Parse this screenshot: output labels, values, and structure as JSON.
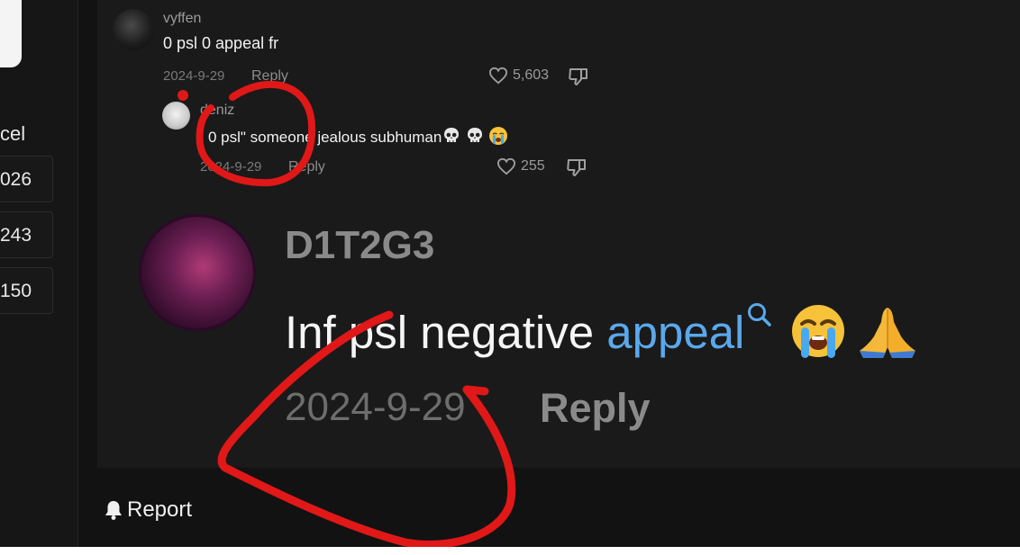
{
  "sidebar": {
    "partial_label": "cel",
    "codes": [
      "026",
      "243",
      "150"
    ]
  },
  "comment_vyffen": {
    "username": "vyffen",
    "text": "0 psl 0 appeal fr",
    "date": "2024-9-29",
    "reply_label": "Reply",
    "likes": "5,603"
  },
  "reply_deniz": {
    "username": "deniz",
    "text": "0 psl\" someone jealous subhuman",
    "emojis": [
      "skull",
      "skull",
      "crying"
    ],
    "date": "2024-9-29",
    "reply_label": "Reply",
    "likes": "255"
  },
  "comment_d1t2g3": {
    "username": "D1T2G3",
    "text_plain": "Inf psl negative ",
    "text_link": "appeal",
    "emojis": [
      "loudly-crying",
      "folded-hands"
    ],
    "date": "2024-9-29",
    "reply_label": "Reply"
  },
  "footer": {
    "report_label": "Report"
  },
  "colors": {
    "background": "#121212",
    "panel": "#1a1a1a",
    "link": "#5aa8ec",
    "annotation": "#e01818"
  }
}
